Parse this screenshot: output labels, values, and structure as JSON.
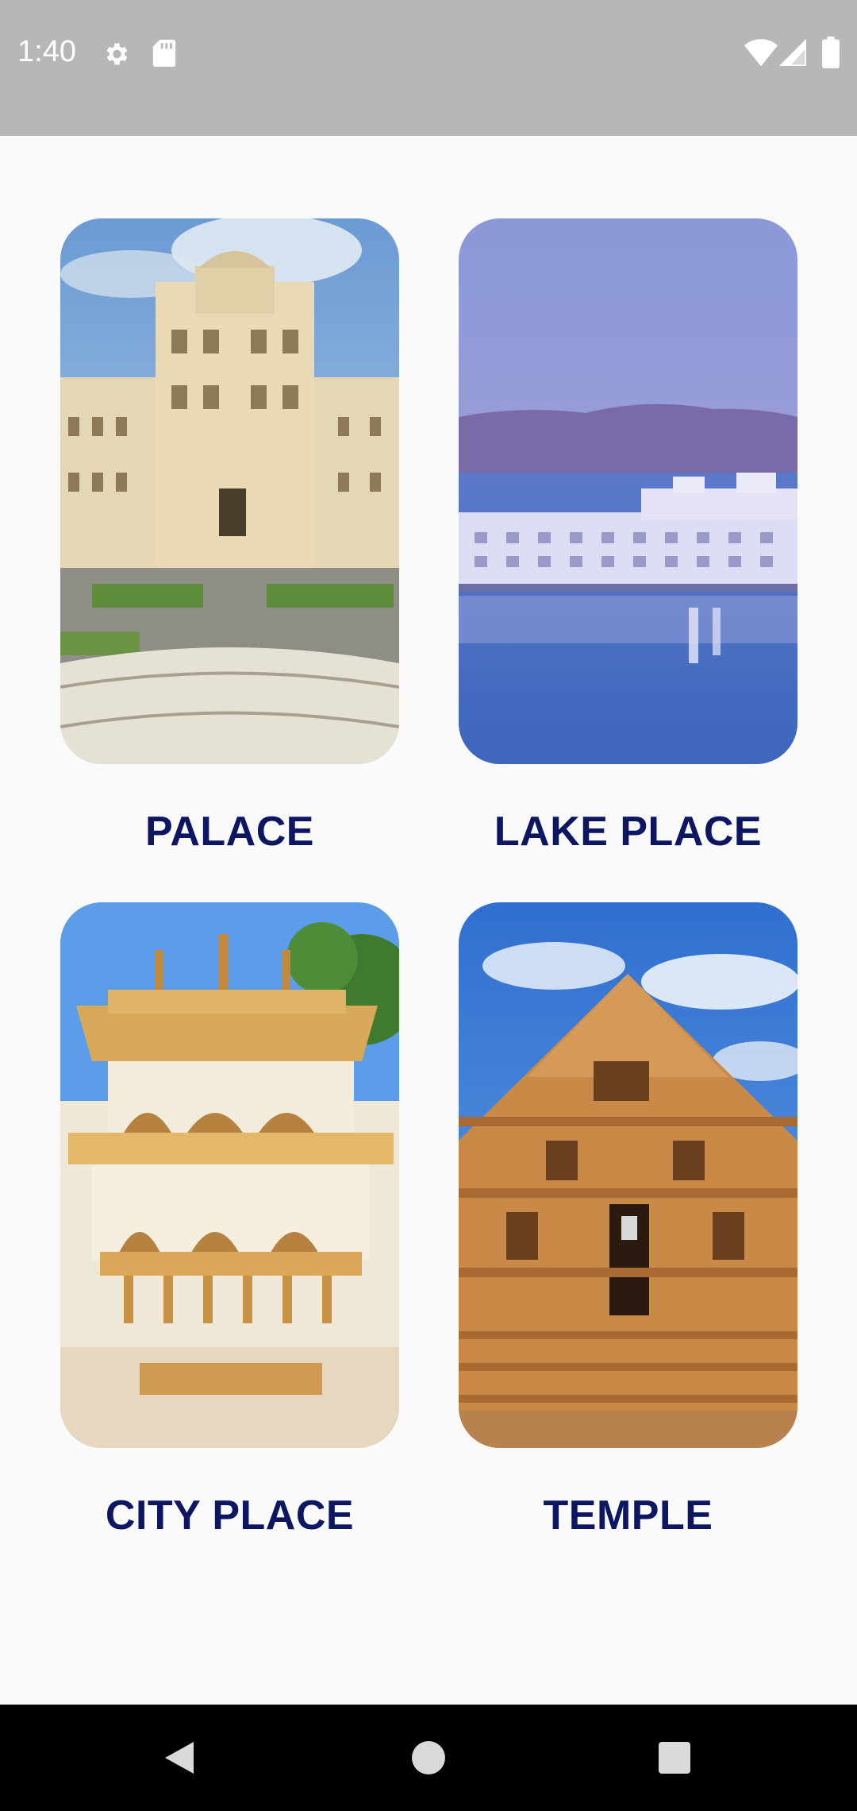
{
  "status_bar": {
    "time": "1:40",
    "icons_left": [
      "settings-icon",
      "sd-card-icon"
    ],
    "icons_right": [
      "wifi-icon",
      "signal-icon",
      "battery-icon"
    ],
    "background": "#b7b7b7"
  },
  "grid": {
    "items": [
      {
        "label": "PALACE",
        "image": "palace-photo"
      },
      {
        "label": "LAKE PLACE",
        "image": "lake-palace-photo"
      },
      {
        "label": "CITY PLACE",
        "image": "city-palace-photo"
      },
      {
        "label": "TEMPLE",
        "image": "temple-photo"
      }
    ],
    "label_color": "#0d1663"
  },
  "nav_bar": {
    "buttons": [
      "back-icon",
      "home-icon",
      "recents-icon"
    ]
  }
}
